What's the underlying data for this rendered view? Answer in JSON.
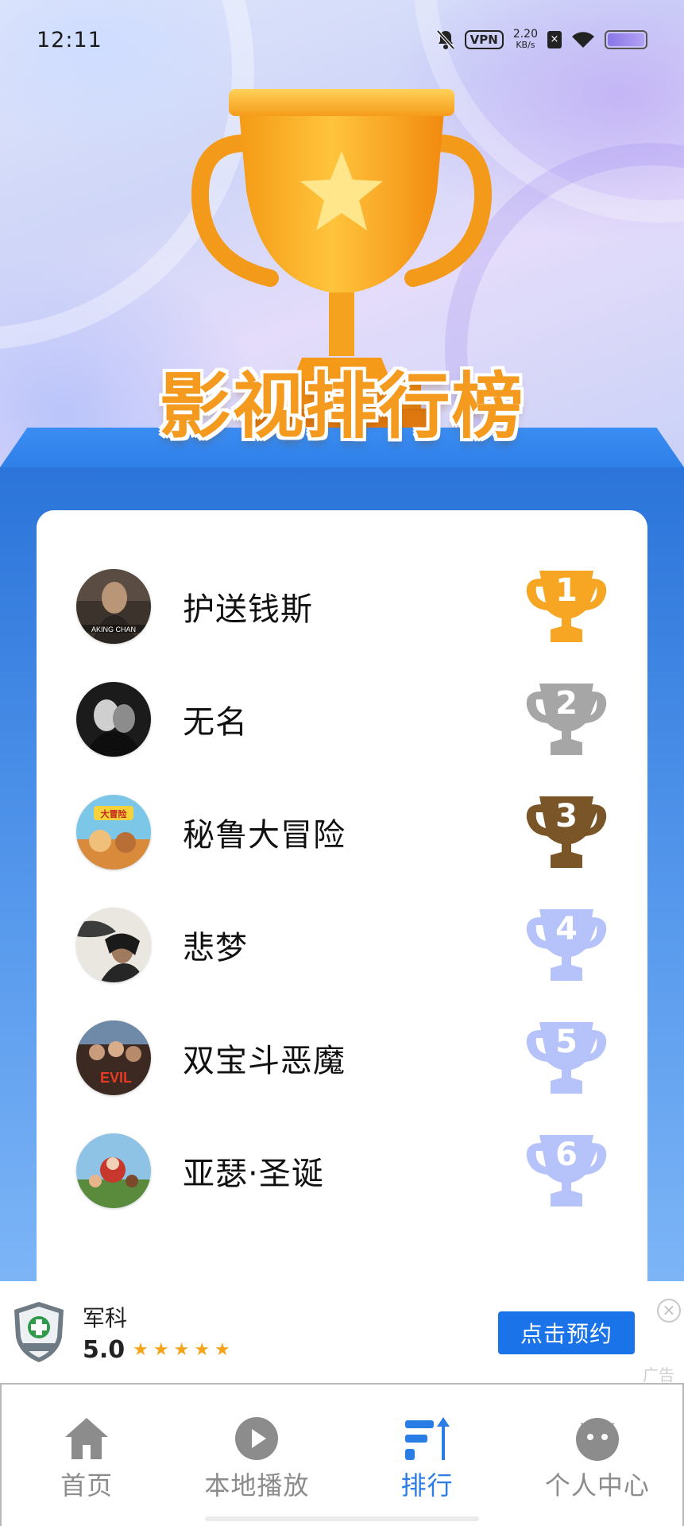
{
  "status_bar": {
    "time": "12:11",
    "vpn": "VPN",
    "speed_value": "2.20",
    "speed_unit": "KB/s",
    "icons": [
      "bell-off-icon",
      "vpn-icon",
      "sim-icon",
      "wifi-icon",
      "battery-icon"
    ]
  },
  "header": {
    "title": "影视排行榜",
    "trophy_icon": "trophy-icon"
  },
  "ranking": {
    "items": [
      {
        "rank": "1",
        "title": "护送钱斯",
        "poster_text": "AKING CHAN",
        "trophy_color": "#f6a623"
      },
      {
        "rank": "2",
        "title": "无名",
        "poster_text": "",
        "trophy_color": "#a6a6a6"
      },
      {
        "rank": "3",
        "title": "秘鲁大冒险",
        "poster_text": "大冒险",
        "trophy_color": "#7a5527"
      },
      {
        "rank": "4",
        "title": "悲梦",
        "poster_text": "",
        "trophy_color": "#b5c3fa"
      },
      {
        "rank": "5",
        "title": "双宝斗恶魔",
        "poster_text": "EVIL",
        "trophy_color": "#b5c3fa"
      },
      {
        "rank": "6",
        "title": "亚瑟·圣诞",
        "poster_text": "",
        "trophy_color": "#b5c3fa"
      }
    ]
  },
  "ad": {
    "name": "军科",
    "rating": "5.0",
    "stars": "★★★★★",
    "cta": "点击预约",
    "close": "×",
    "tag": "广告",
    "logo_text": "军科"
  },
  "bottom_nav": {
    "items": [
      {
        "label": "首页",
        "icon": "home-icon",
        "active": false
      },
      {
        "label": "本地播放",
        "icon": "play-icon",
        "active": false
      },
      {
        "label": "排行",
        "icon": "ranking-icon",
        "active": true
      },
      {
        "label": "个人中心",
        "icon": "profile-icon",
        "active": false
      }
    ]
  },
  "colors": {
    "accent": "#2b7de6",
    "title_orange": "#f39a1f",
    "panel_blue": "#3a8df2"
  }
}
